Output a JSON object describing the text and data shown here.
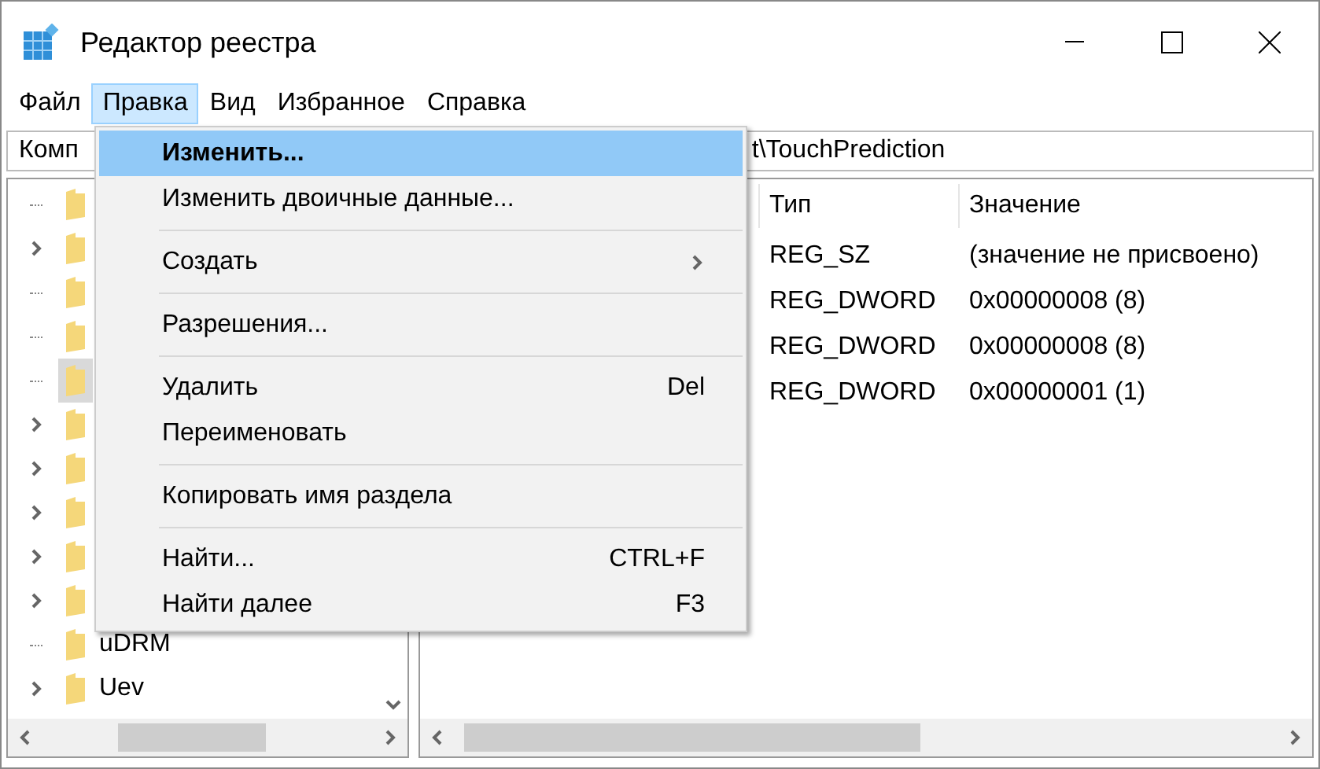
{
  "window": {
    "title": "Редактор реестра"
  },
  "menu_bar": [
    {
      "label": "Файл",
      "selected": false
    },
    {
      "label": "Правка",
      "selected": true
    },
    {
      "label": "Вид",
      "selected": false
    },
    {
      "label": "Избранное",
      "selected": false
    },
    {
      "label": "Справка",
      "selected": false
    }
  ],
  "address_bar": {
    "visible_start": "Комп",
    "visible_end": "t\\TouchPrediction"
  },
  "tree": [
    {
      "expandable": false,
      "selected": false
    },
    {
      "expandable": true,
      "selected": false
    },
    {
      "expandable": false,
      "selected": false
    },
    {
      "expandable": false,
      "selected": false
    },
    {
      "expandable": false,
      "selected": true
    },
    {
      "expandable": true,
      "selected": false
    },
    {
      "expandable": true,
      "selected": false
    },
    {
      "expandable": true,
      "selected": false
    },
    {
      "expandable": true,
      "selected": false
    },
    {
      "expandable": true,
      "selected": false
    },
    {
      "label": "uDRM",
      "expandable": false,
      "selected": false
    },
    {
      "label": "Uev",
      "expandable": true,
      "selected": false
    }
  ],
  "values": {
    "columns": [
      "Тип",
      "Значение"
    ],
    "rows": [
      {
        "type": "REG_SZ",
        "value": "(значение не присвоено)"
      },
      {
        "type": "REG_DWORD",
        "value": "0x00000008 (8)"
      },
      {
        "type": "REG_DWORD",
        "value": "0x00000008 (8)"
      },
      {
        "type": "REG_DWORD",
        "value": "0x00000001 (1)"
      }
    ]
  },
  "edit_menu": [
    {
      "kind": "item",
      "label": "Изменить...",
      "selected": true
    },
    {
      "kind": "item",
      "label": "Изменить двоичные данные...",
      "selected": false
    },
    {
      "kind": "separator"
    },
    {
      "kind": "submenu",
      "label": "Создать",
      "selected": false
    },
    {
      "kind": "separator"
    },
    {
      "kind": "item",
      "label": "Разрешения...",
      "selected": false
    },
    {
      "kind": "separator"
    },
    {
      "kind": "item",
      "label": "Удалить",
      "shortcut": "Del",
      "selected": false
    },
    {
      "kind": "item",
      "label": "Переименовать",
      "selected": false
    },
    {
      "kind": "separator"
    },
    {
      "kind": "item",
      "label": "Копировать имя раздела",
      "selected": false
    },
    {
      "kind": "separator"
    },
    {
      "kind": "item",
      "label": "Найти...",
      "shortcut": "CTRL+F",
      "selected": false
    },
    {
      "kind": "item",
      "label": "Найти далее",
      "shortcut": "F3",
      "selected": false
    }
  ]
}
